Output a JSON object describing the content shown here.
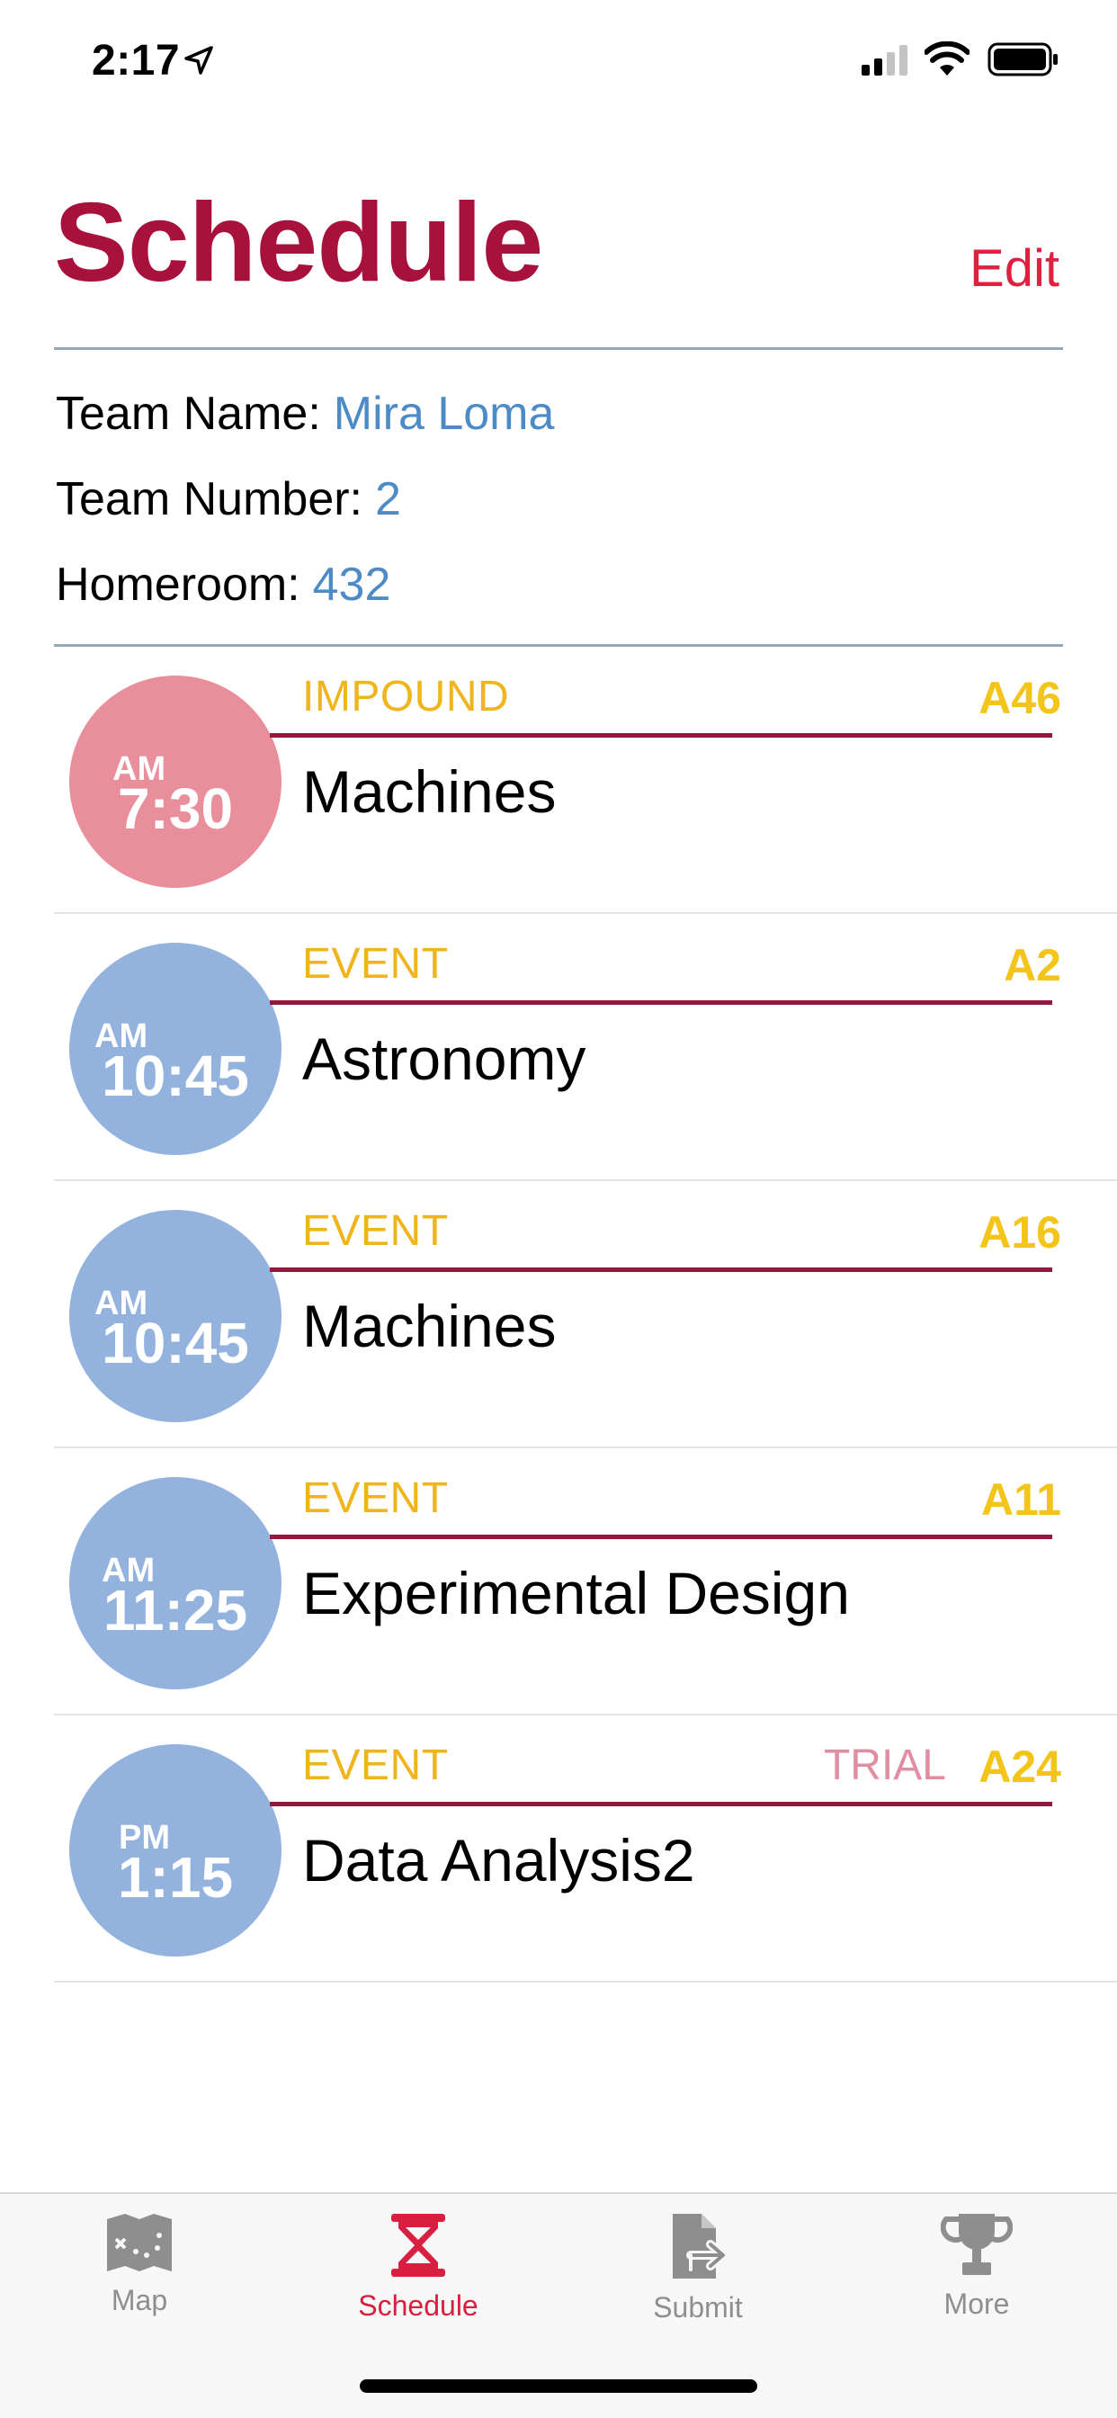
{
  "status_bar": {
    "time": "2:17"
  },
  "header": {
    "title": "Schedule",
    "edit_label": "Edit",
    "title_color": "#a8113c",
    "accent_color": "#e0203f"
  },
  "team": {
    "name_label": "Team Name:",
    "name_value": "Mira Loma",
    "number_label": "Team Number:",
    "number_value": "2",
    "homeroom_label": "Homeroom:",
    "homeroom_value": "432"
  },
  "schedule": [
    {
      "ampm": "AM",
      "time": "7:30",
      "type": "IMPOUND",
      "room": "A46",
      "trial": "",
      "name": "Machines",
      "circle_color": "pink"
    },
    {
      "ampm": "AM",
      "time": "10:45",
      "type": "EVENT",
      "room": "A2",
      "trial": "",
      "name": "Astronomy",
      "circle_color": "blue"
    },
    {
      "ampm": "AM",
      "time": "10:45",
      "type": "EVENT",
      "room": "A16",
      "trial": "",
      "name": "Machines",
      "circle_color": "blue"
    },
    {
      "ampm": "AM",
      "time": "11:25",
      "type": "EVENT",
      "room": "A11",
      "trial": "",
      "name": "Experimental Design",
      "circle_color": "blue"
    },
    {
      "ampm": "PM",
      "time": "1:15",
      "type": "EVENT",
      "room": "A24",
      "trial": "TRIAL",
      "name": "Data Analysis2",
      "circle_color": "blue"
    }
  ],
  "tabs": [
    {
      "label": "Map",
      "icon": "map-icon",
      "active": false
    },
    {
      "label": "Schedule",
      "icon": "hourglass-icon",
      "active": true
    },
    {
      "label": "Submit",
      "icon": "submit-document-icon",
      "active": false
    },
    {
      "label": "More",
      "icon": "trophy-icon",
      "active": false
    }
  ],
  "colors": {
    "type_label": "#f0b51d",
    "room_label": "#f3c51a",
    "trial_label": "#e08ea0",
    "info_value": "#4d8bc7",
    "accent_line": "#95173c",
    "tab_active": "#d91f40",
    "tab_inactive": "#8e8e8e"
  }
}
